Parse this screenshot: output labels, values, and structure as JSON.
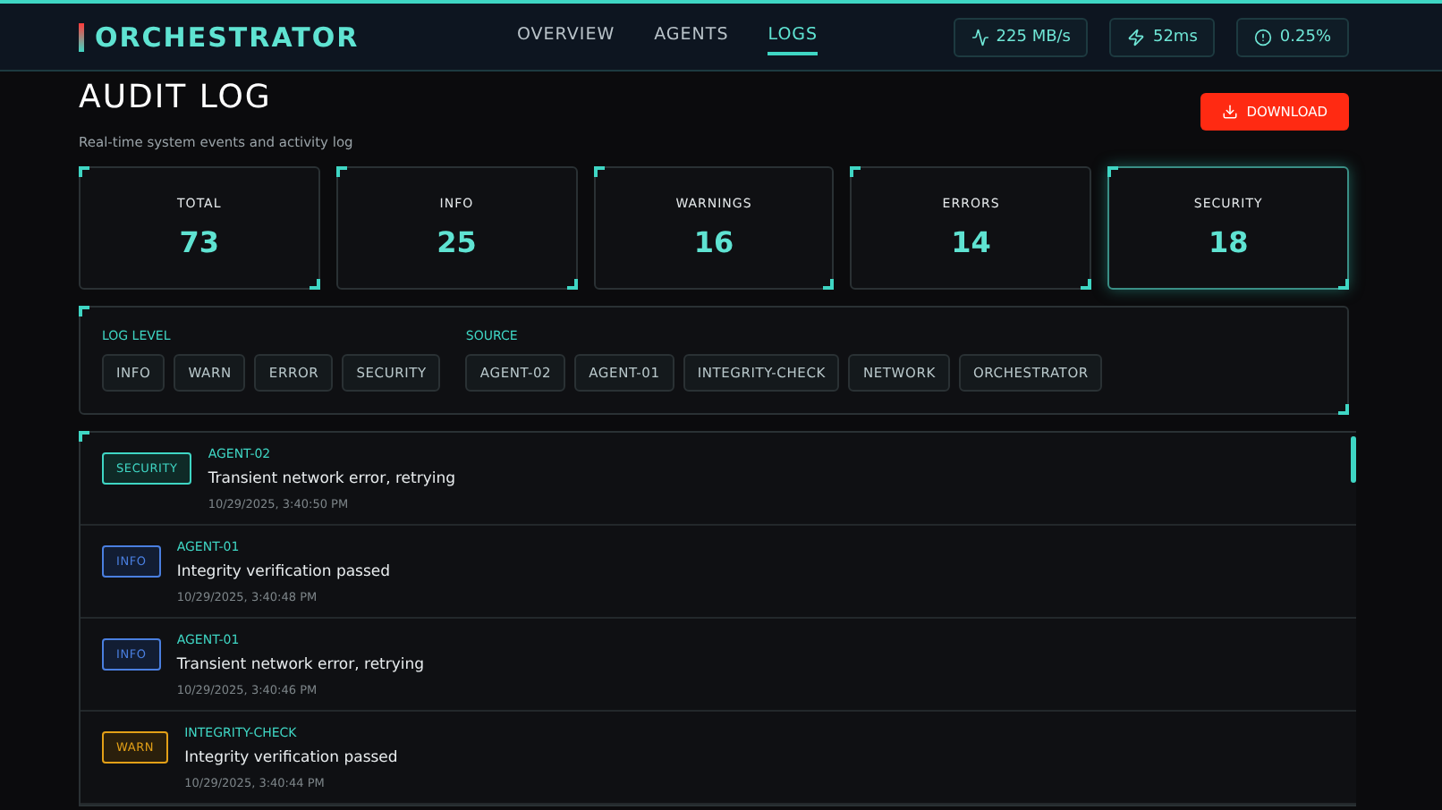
{
  "header": {
    "brand": "ORCHESTRATOR",
    "nav": [
      {
        "label": "OVERVIEW",
        "selected": false
      },
      {
        "label": "AGENTS",
        "selected": false
      },
      {
        "label": "LOGS",
        "selected": true
      }
    ],
    "metrics": [
      {
        "kind": "throughput",
        "value": "225 MB/s"
      },
      {
        "kind": "latency",
        "value": "52ms"
      },
      {
        "kind": "error-rate",
        "value": "0.25%"
      }
    ]
  },
  "page": {
    "title": "AUDIT LOG",
    "subtitle": "Real-time system events and activity log",
    "download": "DOWNLOAD"
  },
  "stats": [
    {
      "label": "TOTAL",
      "value": "73",
      "selected": false
    },
    {
      "label": "INFO",
      "value": "25",
      "selected": false
    },
    {
      "label": "WARNINGS",
      "value": "16",
      "selected": false
    },
    {
      "label": "ERRORS",
      "value": "14",
      "selected": false
    },
    {
      "label": "SECURITY",
      "value": "18",
      "selected": true
    }
  ],
  "filters": {
    "level_label": "LOG LEVEL",
    "levels": [
      "INFO",
      "WARN",
      "ERROR",
      "SECURITY"
    ],
    "source_label": "SOURCE",
    "sources": [
      "AGENT-02",
      "AGENT-01",
      "INTEGRITY-CHECK",
      "NETWORK",
      "ORCHESTRATOR"
    ]
  },
  "entries": [
    {
      "kind": "security",
      "badge": "SECURITY",
      "source": "AGENT-02",
      "message": "Transient network error, retrying",
      "time": "10/29/2025, 3:40:50 PM"
    },
    {
      "kind": "info",
      "badge": "INFO",
      "source": "AGENT-01",
      "message": "Integrity verification passed",
      "time": "10/29/2025, 3:40:48 PM"
    },
    {
      "kind": "info",
      "badge": "INFO",
      "source": "AGENT-01",
      "message": "Transient network error, retrying",
      "time": "10/29/2025, 3:40:46 PM"
    },
    {
      "kind": "warn",
      "badge": "WARN",
      "source": "INTEGRITY-CHECK",
      "message": "Integrity verification passed",
      "time": "10/29/2025, 3:40:44 PM"
    }
  ]
}
